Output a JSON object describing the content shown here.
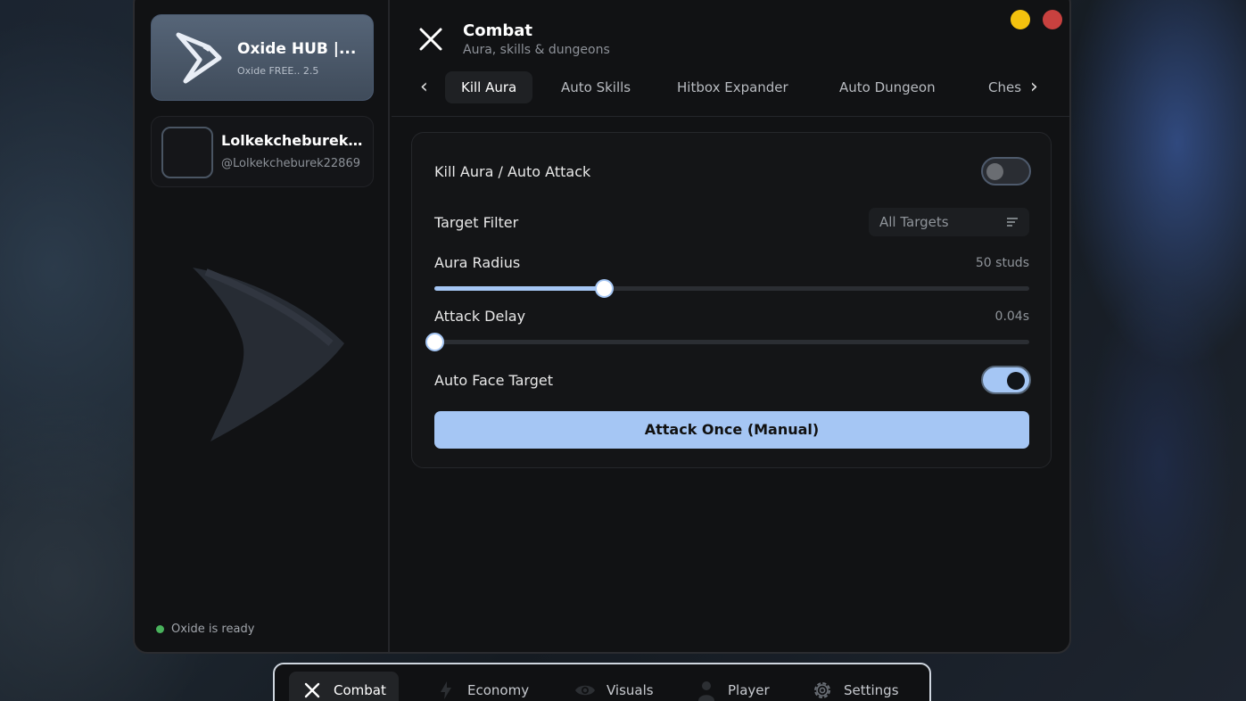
{
  "sidebar": {
    "hub_title": "Oxide HUB |...",
    "hub_subtitle": "Oxide FREE.. 2.5",
    "user_name": "Lolkekcheburek2...",
    "user_handle": "@Lolkekcheburek22869",
    "status_text": "Oxide is ready"
  },
  "header": {
    "title": "Combat",
    "subtitle": "Aura, skills & dungeons"
  },
  "tabs": [
    {
      "label": "Kill Aura",
      "active": true
    },
    {
      "label": "Auto Skills",
      "active": false
    },
    {
      "label": "Hitbox Expander",
      "active": false
    },
    {
      "label": "Auto Dungeon",
      "active": false
    },
    {
      "label": "Ches",
      "active": false
    }
  ],
  "panel": {
    "kill_aura_label": "Kill Aura / Auto Attack",
    "kill_aura_on": false,
    "target_filter_label": "Target Filter",
    "target_filter_value": "All Targets",
    "aura_radius_label": "Aura Radius",
    "aura_radius_value": "50 studs",
    "aura_radius_fraction": 0.285,
    "attack_delay_label": "Attack Delay",
    "attack_delay_value": "0.04s",
    "attack_delay_fraction": 0.0,
    "face_target_label": "Auto Face Target",
    "face_target_on": true,
    "attack_button_label": "Attack Once (Manual)"
  },
  "dock": [
    {
      "label": "Combat",
      "icon": "close-x-icon",
      "active": true
    },
    {
      "label": "Economy",
      "icon": "lightning-icon",
      "active": false
    },
    {
      "label": "Visuals",
      "icon": "eye-icon",
      "active": false
    },
    {
      "label": "Player",
      "icon": "person-icon",
      "active": false
    },
    {
      "label": "Settings",
      "icon": "gear-icon",
      "active": false
    }
  ],
  "colors": {
    "accent": "#a5c6f4",
    "minimize": "#f4c20e",
    "close": "#c8413f",
    "ready": "#49b25c"
  }
}
